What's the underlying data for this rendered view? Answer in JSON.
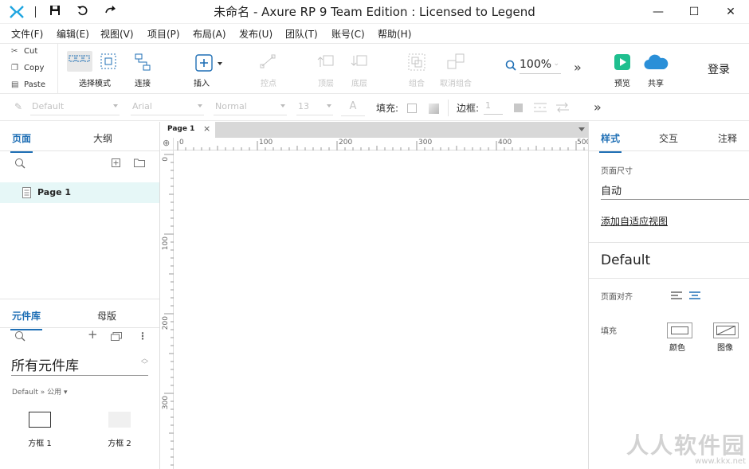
{
  "titlebar": {
    "title": "未命名 - Axure RP 9 Team Edition : Licensed to Legend",
    "save_icon": "save-icon",
    "undo_icon": "undo-icon",
    "redo_icon": "redo-icon",
    "minimize": "—",
    "maximize": "☐",
    "close": "✕"
  },
  "menu": [
    "文件(F)",
    "编辑(E)",
    "视图(V)",
    "项目(P)",
    "布局(A)",
    "发布(U)",
    "团队(T)",
    "账号(C)",
    "帮助(H)"
  ],
  "clipboard": {
    "cut": "Cut",
    "copy": "Copy",
    "paste": "Paste"
  },
  "toolbar": {
    "select_mode": "选择模式",
    "connect": "连接",
    "insert": "插入",
    "point": "控点",
    "top": "顶层",
    "bottom": "底层",
    "group": "组合",
    "ungroup": "取消组合",
    "zoom": "100%",
    "more": "»",
    "preview": "预览",
    "share": "共享",
    "login": "登录"
  },
  "formatbar": {
    "style": "Default",
    "font": "Arial",
    "weight": "Normal",
    "size": "13",
    "fill_label": "填充:",
    "border_label": "边框:",
    "border_value": "1",
    "more": "»"
  },
  "pages_panel": {
    "tab_pages": "页面",
    "tab_outline": "大纲",
    "page_item": "Page 1"
  },
  "library_panel": {
    "tab_library": "元件库",
    "tab_masters": "母版",
    "library_select": "所有元件库",
    "breadcrumb": "Default » 公用 ▾",
    "widget_box1": "方框 1",
    "widget_box2": "方框 2"
  },
  "canvas": {
    "doc_tab": "Page 1",
    "ruler_top": [
      "0",
      "100",
      "200",
      "300",
      "400",
      "500"
    ],
    "ruler_left": [
      "0",
      "100",
      "200",
      "300"
    ]
  },
  "right_panel": {
    "tab_style": "样式",
    "tab_interact": "交互",
    "tab_notes": "注释",
    "page_size_label": "页面尺寸",
    "page_size_value": "自动",
    "adaptive_link": "添加自适应视图",
    "style_name": "Default",
    "align_label": "页面对齐",
    "fill_label": "填充",
    "fill_color": "颜色",
    "fill_image": "图像"
  },
  "watermark": {
    "text": "人人软件园",
    "url": "www.kkx.net"
  },
  "colors": {
    "accent": "#1f6fb5",
    "preview_green": "#1fbf8f",
    "share_blue": "#2a8fd8",
    "selected_row": "#e6f7f7",
    "logo": "#1fa5e0"
  }
}
